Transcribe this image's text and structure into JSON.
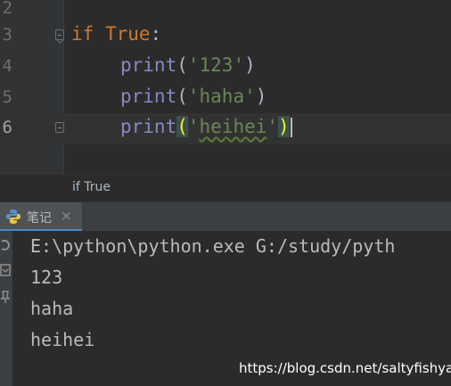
{
  "editor": {
    "lines": [
      {
        "number": "2"
      },
      {
        "number": "3",
        "keyword": "if",
        "value": "True",
        "colon": ":"
      },
      {
        "number": "4",
        "func": "print",
        "open": "(",
        "arg": "'123'",
        "close": ")"
      },
      {
        "number": "5",
        "func": "print",
        "open": "(",
        "arg": "'haha'",
        "close": ")"
      },
      {
        "number": "6",
        "func": "print",
        "open": "(",
        "arg_q1": "'",
        "arg_text": "heihei",
        "arg_q2": "'",
        "close": ")"
      }
    ]
  },
  "breadcrumb": {
    "text": "if True"
  },
  "run_window": {
    "tab_label": "笔记",
    "tab_close": "×",
    "tab_icon": "python-icon",
    "output": [
      "E:\\python\\python.exe G:/study/pyth",
      "123",
      "haha",
      "heihei"
    ]
  },
  "watermark": "https://blog.csdn.net/saltyfishyao",
  "colors": {
    "background": "#2b2b2b",
    "keyword": "#cc7832",
    "function": "#8888c6",
    "string": "#6a8759",
    "brace_match": "#ffef28"
  }
}
